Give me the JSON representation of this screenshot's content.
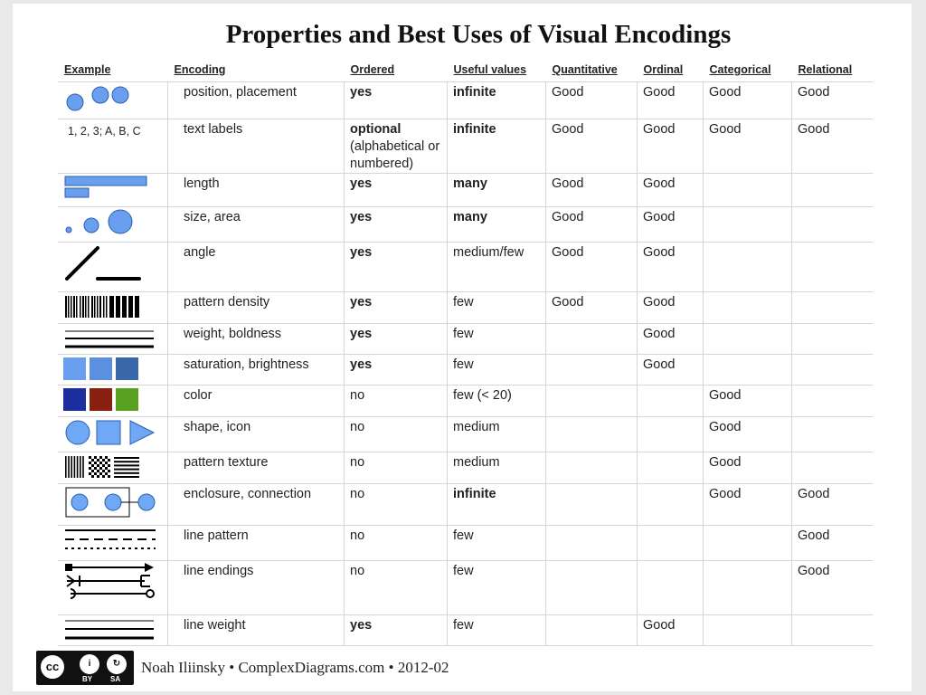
{
  "title": "Properties and Best Uses of Visual Encodings",
  "columns": [
    "Example",
    "Encoding",
    "Ordered",
    "Useful values",
    "Quantitative",
    "Ordinal",
    "Categorical",
    "Relational"
  ],
  "colors": {
    "blue_light": "#6a9ff0",
    "blue_mid": "#5b8fe0",
    "blue_dark": "#3a66aa",
    "navy": "#1d2fa0",
    "maroon": "#8a2010",
    "green": "#58a020",
    "shape_fill": "#6fa8f5"
  },
  "rows": [
    {
      "example": "two-points-icon",
      "encoding": "position, placement",
      "ordered": "yes",
      "ordered_bold": true,
      "values": "infinite",
      "values_bold": true,
      "quantitative": "Good",
      "ordinal": "Good",
      "categorical": "Good",
      "relational": "Good"
    },
    {
      "example": "text-labels",
      "example_text": "1, 2, 3; A, B, C",
      "encoding": "text labels",
      "ordered": "optional",
      "ordered_sub": "(alphabetical or numbered)",
      "ordered_bold": true,
      "values": "infinite",
      "values_bold": true,
      "quantitative": "Good",
      "ordinal": "Good",
      "categorical": "Good",
      "relational": "Good"
    },
    {
      "example": "bars-icon",
      "encoding": "length",
      "ordered": "yes",
      "ordered_bold": true,
      "values": "many",
      "values_bold": true,
      "quantitative": "Good",
      "ordinal": "Good",
      "categorical": "",
      "relational": ""
    },
    {
      "example": "circles-size-icon",
      "encoding": "size, area",
      "ordered": "yes",
      "ordered_bold": true,
      "values": "many",
      "values_bold": true,
      "quantitative": "Good",
      "ordinal": "Good",
      "categorical": "",
      "relational": ""
    },
    {
      "example": "angle-icon",
      "encoding": "angle",
      "ordered": "yes",
      "ordered_bold": true,
      "values": "medium/few",
      "values_bold": false,
      "quantitative": "Good",
      "ordinal": "Good",
      "categorical": "",
      "relational": ""
    },
    {
      "example": "barcode-icon",
      "encoding": "pattern density",
      "ordered": "yes",
      "ordered_bold": true,
      "values": "few",
      "values_bold": false,
      "quantitative": "Good",
      "ordinal": "Good",
      "categorical": "",
      "relational": ""
    },
    {
      "example": "line-weights-icon",
      "encoding": "weight, boldness",
      "ordered": "yes",
      "ordered_bold": true,
      "values": "few",
      "values_bold": false,
      "quantitative": "",
      "ordinal": "Good",
      "categorical": "",
      "relational": ""
    },
    {
      "example": "saturation-swatches-icon",
      "encoding": "saturation, brightness",
      "ordered": "yes",
      "ordered_bold": true,
      "values": "few",
      "values_bold": false,
      "quantitative": "",
      "ordinal": "Good",
      "categorical": "",
      "relational": ""
    },
    {
      "example": "color-swatches-icon",
      "encoding": "color",
      "ordered": "no",
      "ordered_bold": false,
      "values": "few (< 20)",
      "values_bold": false,
      "quantitative": "",
      "ordinal": "",
      "categorical": "Good",
      "relational": ""
    },
    {
      "example": "shapes-icon",
      "encoding": "shape, icon",
      "ordered": "no",
      "ordered_bold": false,
      "values": "medium",
      "values_bold": false,
      "quantitative": "",
      "ordinal": "",
      "categorical": "Good",
      "relational": ""
    },
    {
      "example": "textures-icon",
      "encoding": "pattern texture",
      "ordered": "no",
      "ordered_bold": false,
      "values": "medium",
      "values_bold": false,
      "quantitative": "",
      "ordinal": "",
      "categorical": "Good",
      "relational": ""
    },
    {
      "example": "enclosure-icon",
      "encoding": "enclosure, connection",
      "ordered": "no",
      "ordered_bold": false,
      "values": "infinite",
      "values_bold": true,
      "quantitative": "",
      "ordinal": "",
      "categorical": "Good",
      "relational": "Good"
    },
    {
      "example": "dashed-lines-icon",
      "encoding": "line pattern",
      "ordered": "no",
      "ordered_bold": false,
      "values": "few",
      "values_bold": false,
      "quantitative": "",
      "ordinal": "",
      "categorical": "",
      "relational": "Good"
    },
    {
      "example": "arrow-endings-icon",
      "encoding": "line endings",
      "ordered": "no",
      "ordered_bold": false,
      "values": "few",
      "values_bold": false,
      "quantitative": "",
      "ordinal": "",
      "categorical": "",
      "relational": "Good"
    },
    {
      "example": "line-weight-icon",
      "encoding": "line weight",
      "ordered": "yes",
      "ordered_bold": true,
      "values": "few",
      "values_bold": false,
      "quantitative": "",
      "ordinal": "Good",
      "categorical": "",
      "relational": ""
    }
  ],
  "footer": {
    "license_badge": {
      "by": "BY",
      "sa": "SA"
    },
    "credit": "Noah Iliinsky • ComplexDiagrams.com • 2012-02"
  }
}
